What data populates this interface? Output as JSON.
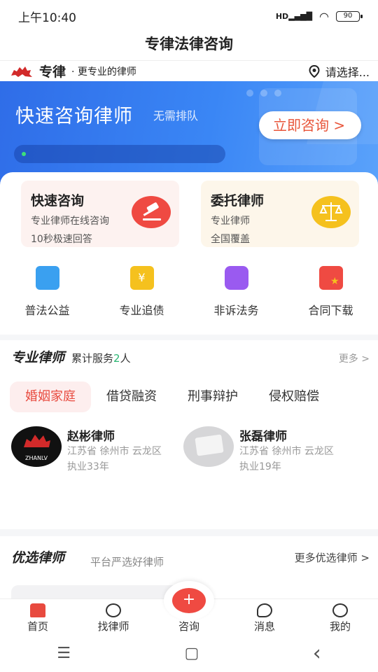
{
  "status": {
    "time": "上午10:40",
    "net": "HD",
    "battery": "90"
  },
  "app": {
    "title": "专律法律咨询"
  },
  "brand": {
    "name": "专律",
    "dot": "·",
    "slogan": "更专业的律师",
    "location": "请选择..."
  },
  "banner": {
    "title": "快速咨询律师",
    "subtitle": "无需排队",
    "button": "立即咨询 >"
  },
  "services": [
    {
      "title": "快速咨询",
      "line1": "专业律师在线咨询",
      "line2": "10秒极速回答"
    },
    {
      "title": "委托律师",
      "line1": "专业律师",
      "line2": "全国覆盖"
    }
  ],
  "features": [
    {
      "label": "普法公益",
      "icon": "book-icon",
      "color": "#3aa0f0"
    },
    {
      "label": "专业追债",
      "icon": "money-icon",
      "color": "#f5c11e"
    },
    {
      "label": "非诉法务",
      "icon": "briefcase-icon",
      "color": "#9a5af0"
    },
    {
      "label": "合同下载",
      "icon": "contract-icon",
      "color": "#ef4a42"
    }
  ],
  "lawyers_section": {
    "title": "专业律师",
    "count_prefix": "累计服务",
    "count": "2",
    "count_suffix": "人",
    "more": "更多 >"
  },
  "tabs": [
    "婚姻家庭",
    "借贷融资",
    "刑事辩护",
    "侵权赔偿"
  ],
  "lawyers": [
    {
      "name": "赵彬律师",
      "location": "江苏省 徐州市 云龙区",
      "years": "执业33年",
      "avatar_text": "ZHANLV"
    },
    {
      "name": "张磊律师",
      "location": "江苏省 徐州市 云龙区",
      "years": "执业19年"
    }
  ],
  "picks": {
    "title": "优选律师",
    "subtitle": "平台严选好律师",
    "more": "更多优选律师 >"
  },
  "tabbar": [
    {
      "label": "首页"
    },
    {
      "label": "找律师"
    },
    {
      "label": "咨询"
    },
    {
      "label": "消息"
    },
    {
      "label": "我的"
    }
  ],
  "navbar": {
    "menu": "☰",
    "home": "▢",
    "back": "‹"
  }
}
